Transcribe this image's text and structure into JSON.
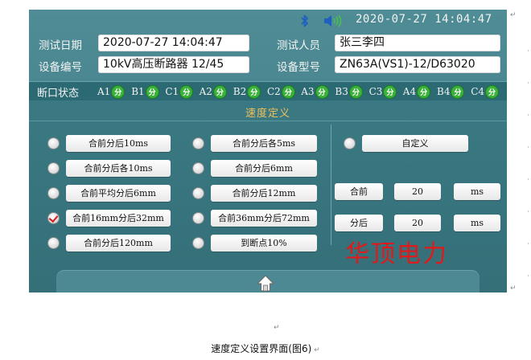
{
  "status": {
    "time": "2020-07-27 14:04:47"
  },
  "info": {
    "test_date_label": "测试日期",
    "test_date_value": "2020-07-27 14:04:47",
    "tester_label": "测试人员",
    "tester_value": "张三李四",
    "device_no_label": "设备编号",
    "device_no_value": "10kV高压断路器 12/45",
    "device_model_label": "设备型号",
    "device_model_value": "ZN63A(VS1)-12/D63020"
  },
  "breakers": {
    "label": "断口状态",
    "items": [
      {
        "name": "A1",
        "state": "分"
      },
      {
        "name": "B1",
        "state": "分"
      },
      {
        "name": "C1",
        "state": "分"
      },
      {
        "name": "A2",
        "state": "分"
      },
      {
        "name": "B2",
        "state": "分"
      },
      {
        "name": "C2",
        "state": "分"
      },
      {
        "name": "A3",
        "state": "分"
      },
      {
        "name": "B3",
        "state": "分"
      },
      {
        "name": "C3",
        "state": "分"
      },
      {
        "name": "A4",
        "state": "分"
      },
      {
        "name": "B4",
        "state": "分"
      },
      {
        "name": "C4",
        "state": "分"
      }
    ]
  },
  "speed": {
    "title": "速度定义",
    "options_col1": [
      "合前分后10ms",
      "合前分后各10ms",
      "合前平均分后6mm",
      "合前16mm分后32mm",
      "合前分后120mm"
    ],
    "options_col2": [
      "合前分后各5ms",
      "合前分后6mm",
      "合前分后12mm",
      "合前36mm分后72mm",
      "到断点10%"
    ],
    "selected": "合前16mm分后32mm",
    "custom_label": "自定义",
    "close_label": "合前",
    "close_value": "20",
    "close_unit": "ms",
    "open_label": "分后",
    "open_value": "20",
    "open_unit": "ms"
  },
  "brand": "华顶电力",
  "caption": "速度定义设置界面(图6)"
}
